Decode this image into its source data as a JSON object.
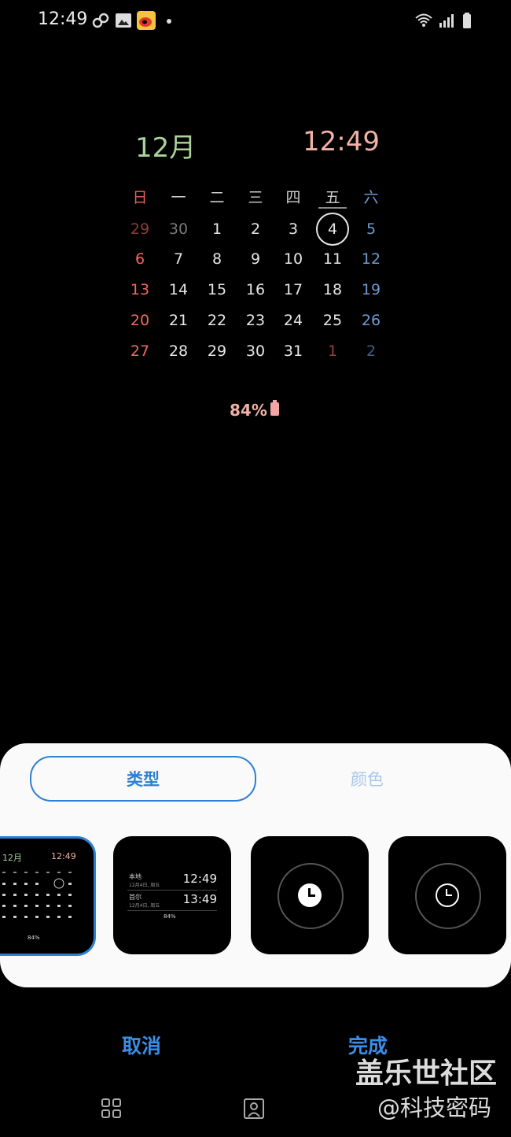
{
  "status_bar": {
    "time": "12:49"
  },
  "widget": {
    "month_title": "12月",
    "clock": "12:49",
    "weekdays": [
      "日",
      "一",
      "二",
      "三",
      "四",
      "五",
      "六"
    ],
    "rows": [
      [
        "29",
        "30",
        "1",
        "2",
        "3",
        "4",
        "5"
      ],
      [
        "6",
        "7",
        "8",
        "9",
        "10",
        "11",
        "12"
      ],
      [
        "13",
        "14",
        "15",
        "16",
        "17",
        "18",
        "19"
      ],
      [
        "20",
        "21",
        "22",
        "23",
        "24",
        "25",
        "26"
      ],
      [
        "27",
        "28",
        "29",
        "30",
        "31",
        "1",
        "2"
      ]
    ],
    "battery": "84%"
  },
  "sheet": {
    "tab_type": "类型",
    "tab_color": "颜色",
    "styles": {
      "calendar_preview": {
        "month": "12月",
        "time": "12:49",
        "battery": "84%"
      },
      "dual_clock_preview": {
        "local_label": "本地",
        "local_date": "12月4日, 周五",
        "local_time": "12:49",
        "seoul_label": "首尔",
        "seoul_date": "12月4日, 周五",
        "seoul_time": "13:49",
        "battery": "84%"
      }
    }
  },
  "actions": {
    "cancel": "取消",
    "done": "完成"
  },
  "watermark": {
    "line1": "盖乐世社区",
    "line2": "@科技密码"
  }
}
